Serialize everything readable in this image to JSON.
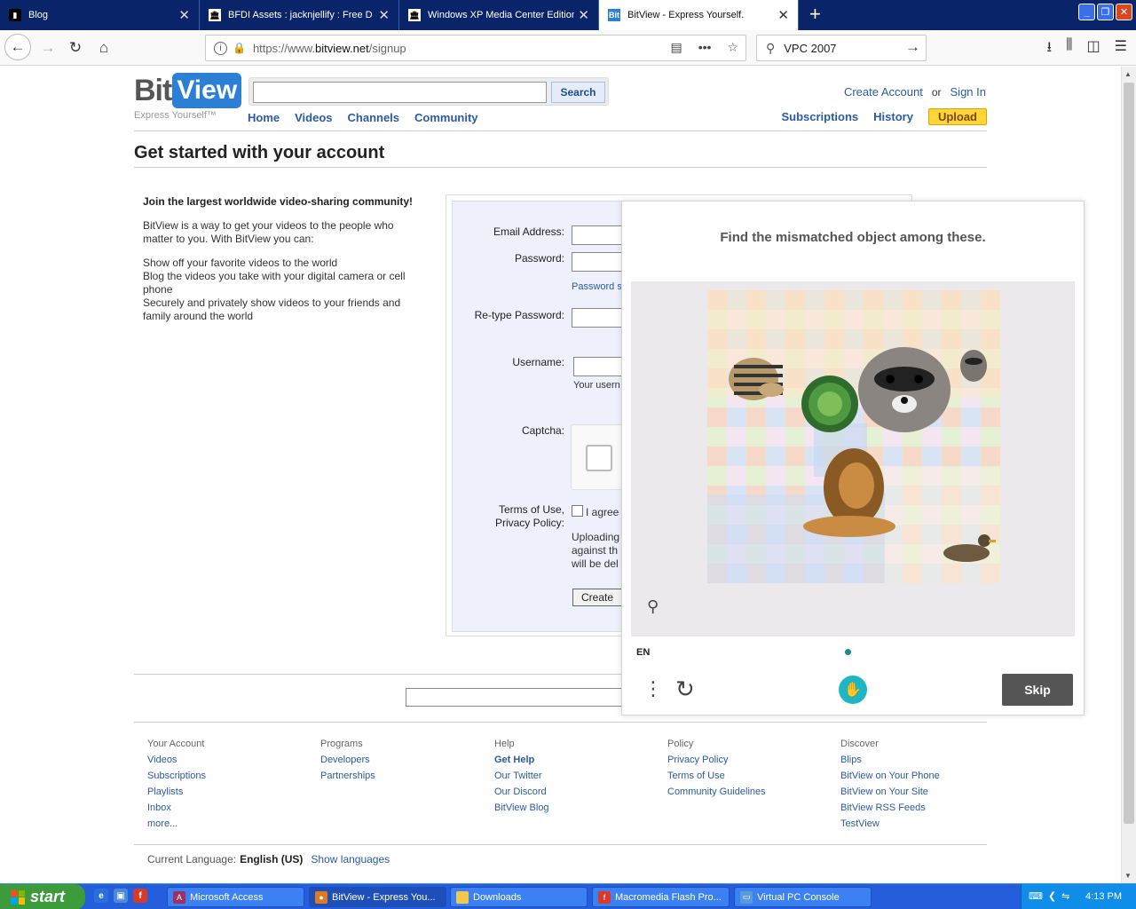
{
  "browser": {
    "tabs": [
      {
        "label": "Blog",
        "icon": "blog-favicon-icon",
        "active": false
      },
      {
        "label": "BFDI Assets : jacknjellify : Free D",
        "icon": "archive-favicon-icon",
        "active": false
      },
      {
        "label": "Windows XP Media Center Edition",
        "icon": "archive-favicon-icon",
        "active": false
      },
      {
        "label": "BitView - Express Yourself.",
        "icon": "bitview-favicon-icon",
        "active": true
      }
    ],
    "url_prefix": "https://www.",
    "url_domain": "bitview.net",
    "url_path": "/signup",
    "search_value": "VPC 2007"
  },
  "site": {
    "logo_bit": "Bit",
    "logo_view": "View",
    "tagline": "Express Yourself™",
    "search_button": "Search",
    "nav": [
      "Home",
      "Videos",
      "Channels",
      "Community"
    ],
    "create_account": "Create Account",
    "or": "or",
    "sign_in": "Sign In",
    "subnav": {
      "subscriptions": "Subscriptions",
      "history": "History",
      "upload": "Upload"
    },
    "accent": "#2a5aa8",
    "upload_color": "#ffd53a"
  },
  "page": {
    "title": "Get started with your account",
    "intro_lead": "Join the largest worldwide video-sharing community!",
    "intro_p1": "BitView is a way to get your videos to the people who matter to you. With BitView you can:",
    "intro_p2_lines": [
      "Show off your favorite videos to the world",
      "Blog the videos you take with your digital camera or cell phone",
      "Securely and privately show videos to your friends and family around the world"
    ]
  },
  "form": {
    "email_label": "Email Address:",
    "password_label": "Password:",
    "password_hint": "Password s",
    "retype_label": "Re-type Password:",
    "username_label": "Username:",
    "username_hint": "Your usern",
    "captcha_label": "Captcha:",
    "terms_label_1": "Terms of Use,",
    "terms_label_2": "Privacy Policy:",
    "agree_text": "I agree",
    "upload_notice_1": "Uploading",
    "upload_notice_2": "against th",
    "upload_notice_3": "will be del",
    "create_button": "Create"
  },
  "captcha_modal": {
    "prompt": "Find the mismatched object among these.",
    "language": "EN",
    "skip": "Skip",
    "brand_color": "#1cb6c4"
  },
  "footer": {
    "columns": [
      {
        "heading": "Your Account",
        "links": [
          "Videos",
          "Subscriptions",
          "Playlists",
          "Inbox",
          "more..."
        ]
      },
      {
        "heading": "Programs",
        "links": [
          "Developers",
          "Partnerships"
        ]
      },
      {
        "heading": "Help",
        "links": [
          "Get Help",
          "Our Twitter",
          "Our Discord",
          "BitView Blog"
        ]
      },
      {
        "heading": "Policy",
        "links": [
          "Privacy Policy",
          "Terms of Use",
          "Community Guidelines"
        ]
      },
      {
        "heading": "Discover",
        "links": [
          "Blips",
          "BitView on Your Phone",
          "BitView on Your Site",
          "BitView RSS Feeds",
          "TestView"
        ]
      }
    ],
    "language_label": "Current Language:",
    "language_value": "English (US)",
    "show_languages": "Show languages"
  },
  "taskbar": {
    "start": "start",
    "buttons": [
      {
        "label": "Microsoft Access",
        "icon": "access-icon",
        "active": false
      },
      {
        "label": "BitView - Express You...",
        "icon": "firefox-icon",
        "active": true
      },
      {
        "label": "Downloads",
        "icon": "folder-icon",
        "active": false
      },
      {
        "label": "Macromedia Flash Pro...",
        "icon": "flash-icon",
        "active": false
      },
      {
        "label": "Virtual PC Console",
        "icon": "virtualpc-icon",
        "active": false
      }
    ],
    "clock": "4:13 PM"
  }
}
